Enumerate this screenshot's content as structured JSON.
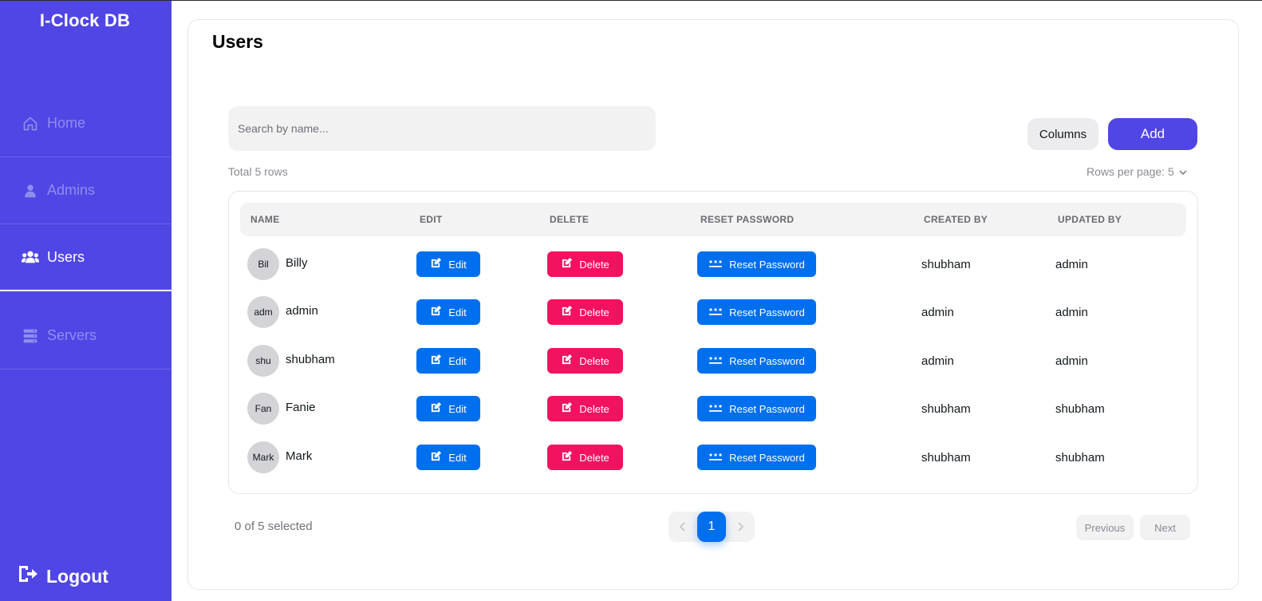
{
  "app": {
    "title": "I-Clock DB"
  },
  "sidebar": {
    "items": [
      {
        "label": "Home",
        "icon": "home-icon",
        "active": false
      },
      {
        "label": "Admins",
        "icon": "user-icon",
        "active": false
      },
      {
        "label": "Users",
        "icon": "users-icon",
        "active": true
      },
      {
        "label": "Servers",
        "icon": "server-icon",
        "active": false
      }
    ],
    "logout_label": "Logout"
  },
  "page": {
    "title": "Users"
  },
  "search": {
    "placeholder": "Search by name...",
    "value": ""
  },
  "toolbar": {
    "columns_label": "Columns",
    "add_label": "Add"
  },
  "table_info": {
    "total": "Total 5 rows",
    "rows_per_page": "Rows per page: 5"
  },
  "table": {
    "headers": [
      "NAME",
      "EDIT",
      "DELETE",
      "RESET PASSWORD",
      "CREATED BY",
      "UPDATED BY"
    ],
    "rows": [
      {
        "avatar": "Bil",
        "name": "Billy",
        "edit": "Edit",
        "delete": "Delete",
        "reset": "Reset Password",
        "created_by": "shubham",
        "updated_by": "admin"
      },
      {
        "avatar": "adm",
        "name": "admin",
        "edit": "Edit",
        "delete": "Delete",
        "reset": "Reset Password",
        "created_by": "admin",
        "updated_by": "admin"
      },
      {
        "avatar": "shu",
        "name": "shubham",
        "edit": "Edit",
        "delete": "Delete",
        "reset": "Reset Password",
        "created_by": "admin",
        "updated_by": "admin"
      },
      {
        "avatar": "Fan",
        "name": "Fanie",
        "edit": "Edit",
        "delete": "Delete",
        "reset": "Reset Password",
        "created_by": "shubham",
        "updated_by": "shubham"
      },
      {
        "avatar": "Mark",
        "name": "Mark",
        "edit": "Edit",
        "delete": "Delete",
        "reset": "Reset Password",
        "created_by": "shubham",
        "updated_by": "shubham"
      }
    ]
  },
  "footer": {
    "selected": "0 of 5 selected",
    "current_page": "1",
    "previous_label": "Previous",
    "next_label": "Next"
  },
  "colors": {
    "brand": "#5046e5",
    "primary": "#006fee",
    "danger": "#f31260"
  }
}
